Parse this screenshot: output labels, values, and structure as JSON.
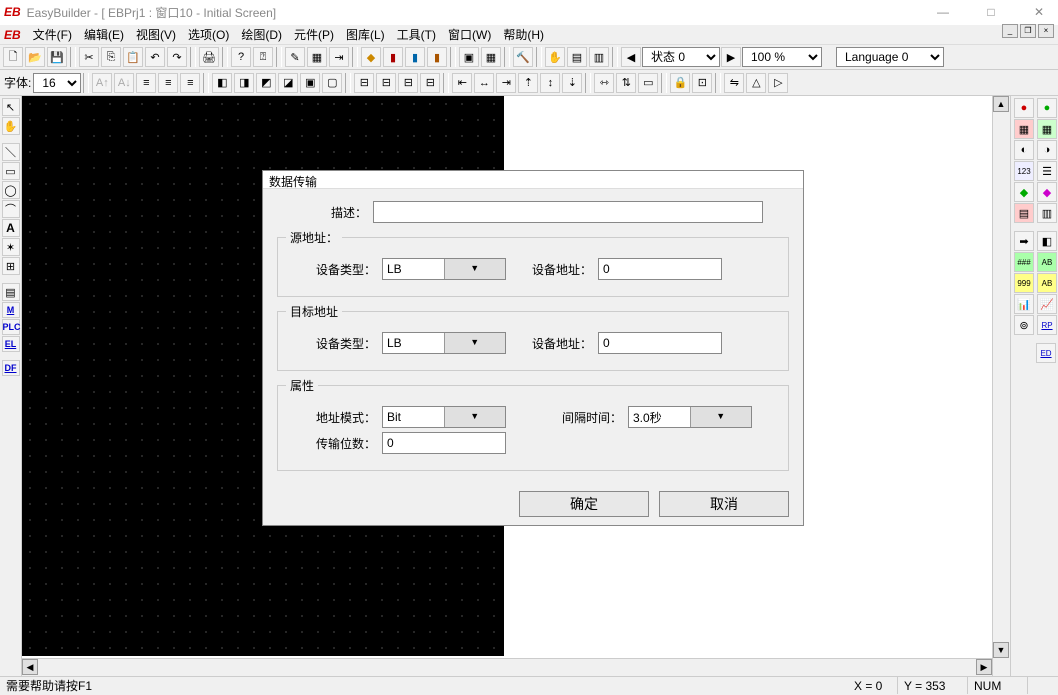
{
  "window": {
    "app_logo": "EB",
    "title": "EasyBuilder - [   EBPrj1  :  窗口10  -  Initial Screen]"
  },
  "menu": {
    "items": [
      "文件(F)",
      "编辑(E)",
      "视图(V)",
      "选项(O)",
      "绘图(D)",
      "元件(P)",
      "图库(L)",
      "工具(T)",
      "窗口(W)",
      "帮助(H)"
    ]
  },
  "toolbar_combos": {
    "state": "状态 0",
    "zoom": "100 %",
    "language": "Language 0"
  },
  "font_row": {
    "font_label": "字体:",
    "font_size": "16"
  },
  "left_tools": [
    "M",
    "PLC",
    "EL",
    "DF"
  ],
  "right_tools": [
    "RP",
    "ED"
  ],
  "dialog": {
    "title": "数据传输",
    "desc_label": "描述：",
    "desc_value": "",
    "src_group": "源地址：",
    "dst_group": "目标地址",
    "attr_group": "属性",
    "dev_type_label": "设备类型：",
    "dev_addr_label": "设备地址：",
    "src_dev_type": "LB",
    "src_dev_addr": "0",
    "dst_dev_type": "LB",
    "dst_dev_addr": "0",
    "addr_mode_label": "地址模式：",
    "addr_mode": "Bit",
    "interval_label": "间隔时间：",
    "interval": "3.0秒",
    "bits_label": "传输位数：",
    "bits_value": "0",
    "ok": "确定",
    "cancel": "取消"
  },
  "status": {
    "help": "需要帮助请按F1",
    "x": "X = 0",
    "y": "Y = 353",
    "num": "NUM"
  }
}
